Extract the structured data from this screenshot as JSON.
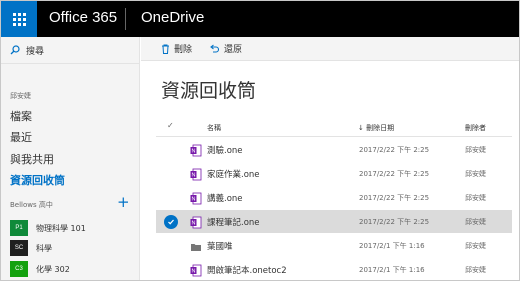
{
  "topbar": {
    "suite": "Office 365",
    "app": "OneDrive"
  },
  "nav": {
    "search": "搜尋",
    "owner": "邱安婕",
    "items": [
      {
        "label": "檔案"
      },
      {
        "label": "最近"
      },
      {
        "label": "與我共用"
      },
      {
        "label": "資源回收筒",
        "active": true
      }
    ],
    "group": "Bellows 高中",
    "sites": [
      {
        "tile": "P1",
        "color": "#0f8a3a",
        "label": "物理科學 101"
      },
      {
        "tile": "SC",
        "color": "#1f1f1f",
        "label": "科學"
      },
      {
        "tile": "C3",
        "color": "#13a10e",
        "label": "化學 302"
      }
    ]
  },
  "commands": {
    "delete": "刪除",
    "restore": "還原"
  },
  "main": {
    "title": "資源回收筒",
    "columns": {
      "name": "名稱",
      "date": "刪除日期",
      "by": "刪除者"
    },
    "rows": [
      {
        "icon": "onenote-icon",
        "name": "測驗.one",
        "date": "2017/2/22 下午 2:25",
        "by": "邱安婕",
        "selected": false
      },
      {
        "icon": "onenote-icon",
        "name": "家庭作業.one",
        "date": "2017/2/22 下午 2:25",
        "by": "邱安婕",
        "selected": false
      },
      {
        "icon": "onenote-icon",
        "name": "講義.one",
        "date": "2017/2/22 下午 2:25",
        "by": "邱安婕",
        "selected": false
      },
      {
        "icon": "onenote-icon",
        "name": "課程筆記.one",
        "date": "2017/2/22 下午 2:25",
        "by": "邱安婕",
        "selected": true
      },
      {
        "icon": "folder-icon",
        "name": "葉國唯",
        "date": "2017/2/1 下午 1:16",
        "by": "邱安婕",
        "selected": false
      },
      {
        "icon": "onenote-icon",
        "name": "開啟筆記本.onetoc2",
        "date": "2017/2/1 下午 1:16",
        "by": "邱安婕",
        "selected": false
      }
    ]
  },
  "colors": {
    "brand": "#0072c6",
    "onenote": "#7719aa",
    "selection": "#dbdbdb"
  }
}
